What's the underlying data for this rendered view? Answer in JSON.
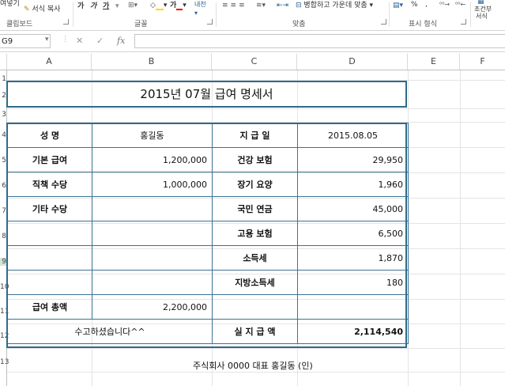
{
  "ribbon": {
    "clipboard": {
      "format_painter_label": "서식 복사",
      "cut_stub": "여넣기",
      "group_label": "클립보드"
    },
    "font": {
      "bold": "가",
      "italic": "가",
      "underline": "가",
      "group_label": "글꼴"
    },
    "alignment": {
      "wrap_label": "",
      "merge_label": "병합하고 가운데 맞춤",
      "group_label": "맞춤"
    },
    "number": {
      "percent": "%",
      "comma": ",",
      "group_label": "표시 형식"
    },
    "styles": {
      "cond_format_label": "조건부",
      "cond_format_sub": "서식"
    }
  },
  "formula_bar": {
    "name_box": "G9",
    "fx_label": "fx",
    "value": ""
  },
  "columns": [
    "A",
    "B",
    "C",
    "D",
    "E",
    "F"
  ],
  "rows": [
    "1",
    "2",
    "3",
    "4",
    "5",
    "6",
    "7",
    "8",
    "9",
    "10",
    "11",
    "12",
    "13"
  ],
  "sheet": {
    "title": "2015년  07월 급여 명세서",
    "name_label": "성     명",
    "name_value": "홍길동",
    "paydate_label": "지  급  일",
    "paydate_value": "2015.08.05",
    "base_label": "기본 급여",
    "base_value": "1,200,000",
    "health_label": "건강 보험",
    "health_value": "29,950",
    "duty_label": "직책 수당",
    "duty_value": "1,000,000",
    "ltc_label": "장기 요양",
    "ltc_value": "1,960",
    "other_label": "기타 수당",
    "other_value": "",
    "pension_label": "국민 연금",
    "pension_value": "45,000",
    "employ_label": "고용 보험",
    "employ_value": "6,500",
    "income_label": "소득세",
    "income_value": "1,870",
    "local_label": "지방소득세",
    "local_value": "180",
    "total_label": "급여    총액",
    "total_value": "2,200,000",
    "thanks": "수고하셨습니다^^",
    "net_label": "실  지  급  액",
    "net_value": "2,114,540",
    "footer": "주식회사 0000      대표  홍길동   (인)"
  }
}
